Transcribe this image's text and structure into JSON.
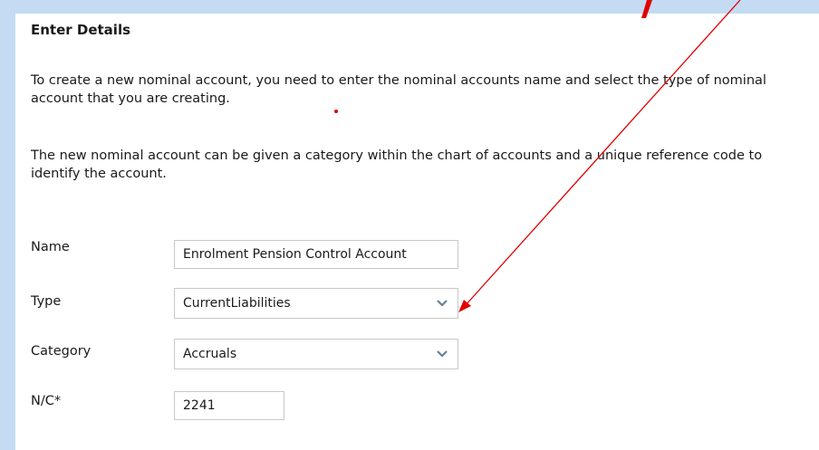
{
  "form": {
    "title": "Enter Details",
    "intro_1": "To create a new nominal account, you need to enter the nominal accounts name and select the type of nominal account that you are creating.",
    "intro_2": "The new nominal account can be given a category within the chart of accounts and a unique reference code to identify the account.",
    "name_label": "Name",
    "name_value": "Enrolment Pension Control Account",
    "type_label": "Type",
    "type_value": "CurrentLiabilities",
    "category_label": "Category",
    "category_value": "Accruals",
    "nc_label": "N/C*",
    "nc_value": "2241"
  },
  "colors": {
    "background": "#c4dbf3",
    "panel": "#ffffff",
    "annotation_arrow": "#e00000"
  },
  "icons": [
    "chevron-down-icon",
    "annotation-arrow"
  ]
}
